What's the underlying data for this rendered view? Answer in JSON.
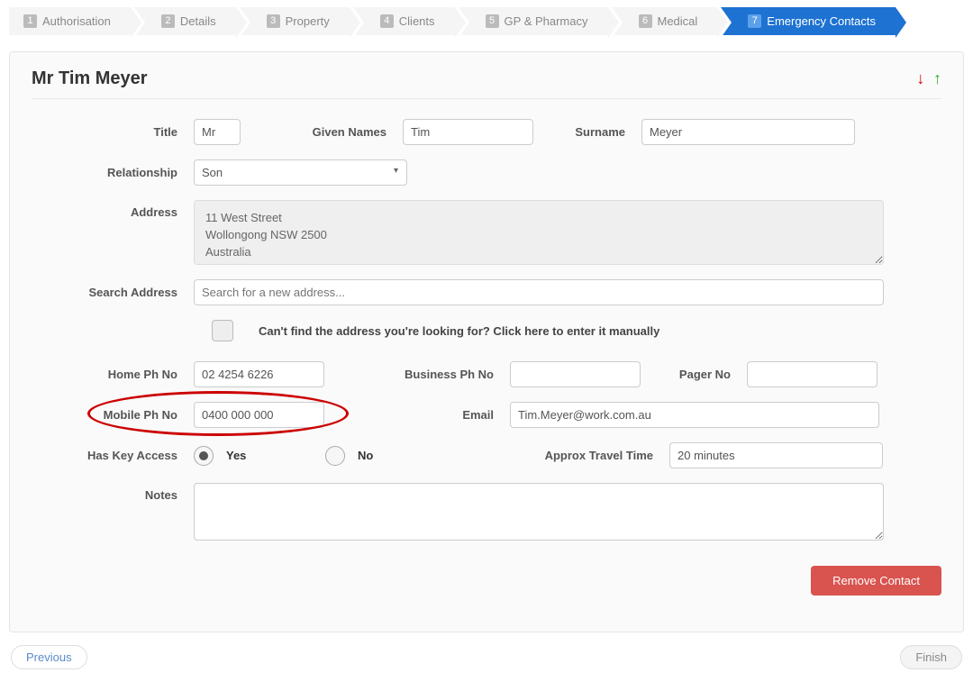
{
  "steps": [
    {
      "num": "1",
      "label": "Authorisation"
    },
    {
      "num": "2",
      "label": "Details"
    },
    {
      "num": "3",
      "label": "Property"
    },
    {
      "num": "4",
      "label": "Clients"
    },
    {
      "num": "5",
      "label": "GP & Pharmacy"
    },
    {
      "num": "6",
      "label": "Medical"
    },
    {
      "num": "7",
      "label": "Emergency Contacts"
    }
  ],
  "active_step": 6,
  "header": {
    "title": "Mr Tim Meyer"
  },
  "labels": {
    "title": "Title",
    "given": "Given Names",
    "surname": "Surname",
    "relationship": "Relationship",
    "address": "Address",
    "search_addr": "Search Address",
    "manual": "Can't find the address you're looking for? Click here to enter it manually",
    "home_ph": "Home Ph No",
    "business_ph": "Business Ph No",
    "pager": "Pager No",
    "mobile": "Mobile Ph No",
    "email": "Email",
    "has_key": "Has Key Access",
    "yes": "Yes",
    "no": "No",
    "travel": "Approx Travel Time",
    "notes": "Notes",
    "remove": "Remove Contact",
    "previous": "Previous",
    "finish": "Finish"
  },
  "values": {
    "title": "Mr",
    "given": "Tim",
    "surname": "Meyer",
    "relationship": "Son",
    "address": "11 West Street\nWollongong NSW 2500\nAustralia",
    "search_placeholder": "Search for a new address...",
    "home_ph": "02 4254 6226",
    "business_ph": "",
    "pager": "",
    "mobile": "0400 000 000",
    "email": "Tim.Meyer@work.com.au",
    "has_key": "yes",
    "travel": "20 minutes",
    "notes": ""
  }
}
